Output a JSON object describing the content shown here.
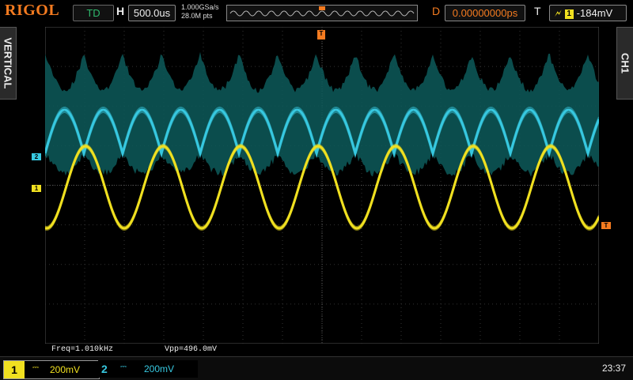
{
  "brand": "RIGOL",
  "top": {
    "run_mode": "TD",
    "h_label": "H",
    "timebase": "500.0us",
    "sample_rate": "1.000GSa/s",
    "mem_depth": "28.0M pts",
    "delay_label": "D",
    "delay": "0.00000000ps",
    "trig_label": "T",
    "trig_source": "1",
    "trig_level": "-184mV",
    "trig_marker": "T"
  },
  "side": {
    "left_tab": "VERTICAL",
    "right_tab": "CH1"
  },
  "markers": {
    "ch1": "1",
    "ch2": "2",
    "trig": "T"
  },
  "measurements": {
    "freq": "Freq=1.010kHz",
    "vpp": "Vpp=496.0mV"
  },
  "channels": [
    {
      "num": "1",
      "scale": "200mV",
      "coupling": "DC",
      "color": "#f0e020"
    },
    {
      "num": "2",
      "scale": "200mV",
      "coupling": "DC",
      "color": "#37c8e0"
    }
  ],
  "clock": "23:37",
  "colors": {
    "brand": "#f47b20",
    "ch1": "#f0e020",
    "ch2": "#37c8e0",
    "noise": "#0d5a5a"
  }
}
